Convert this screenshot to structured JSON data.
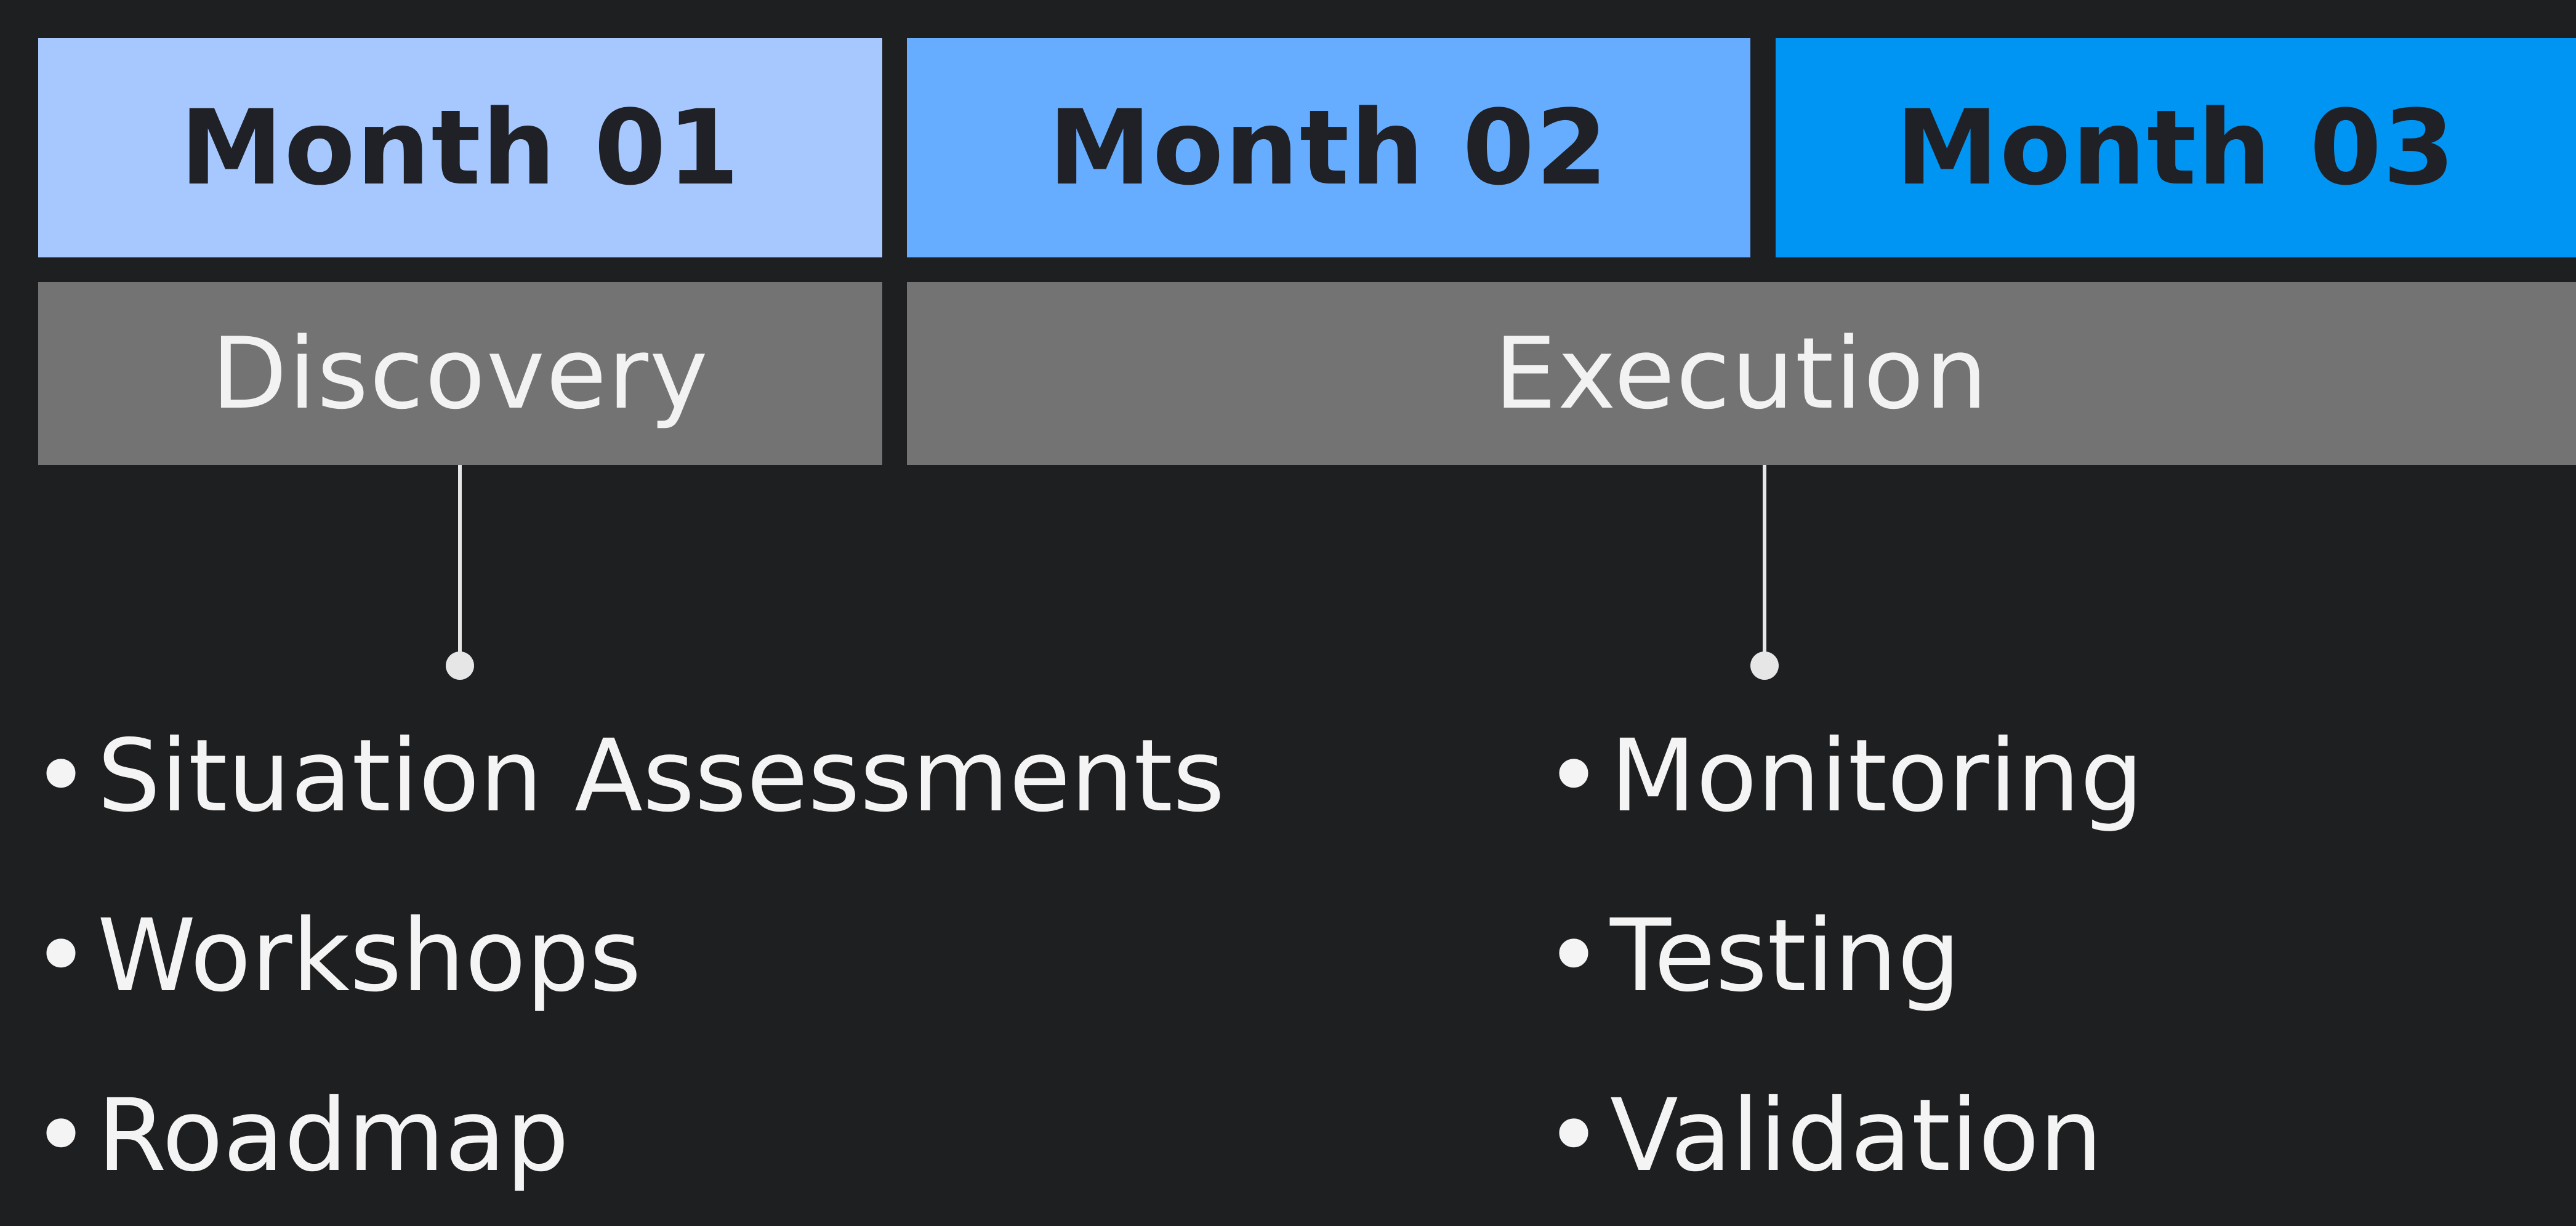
{
  "months": [
    {
      "label": "Month 01",
      "color": "#a6c8ff"
    },
    {
      "label": "Month 02",
      "color": "#67adff"
    },
    {
      "label": "Month 03",
      "color": "#0095f2"
    }
  ],
  "phases": [
    {
      "label": "Discovery",
      "items": [
        "Situation Assessments",
        "Workshops",
        "Roadmap"
      ]
    },
    {
      "label": "Execution",
      "items": [
        "Monitoring",
        "Testing",
        "Validation"
      ]
    }
  ],
  "colors": {
    "background": "#1e1f21",
    "phase_bar": "#737373",
    "connector": "#e6e6e6",
    "text_light": "#f4f4f4",
    "text_dark": "#1f2126"
  }
}
